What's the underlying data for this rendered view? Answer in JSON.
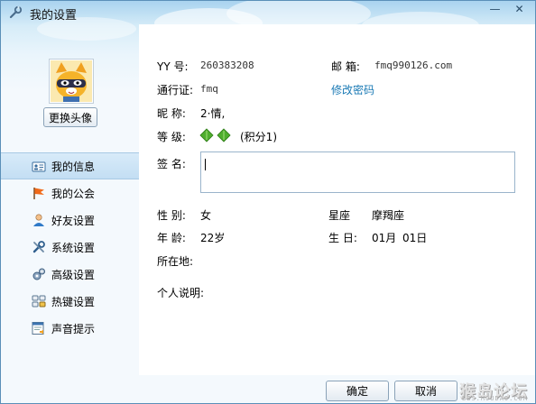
{
  "window": {
    "title": "我的设置",
    "controls": {
      "minimize": "—",
      "close": "✕"
    }
  },
  "sidebar": {
    "change_avatar_label": "更换头像",
    "items": [
      {
        "label": "我的信息",
        "icon": "card-icon",
        "active": true
      },
      {
        "label": "我的公会",
        "icon": "flag-icon",
        "active": false
      },
      {
        "label": "好友设置",
        "icon": "person-icon",
        "active": false
      },
      {
        "label": "系统设置",
        "icon": "wrench-icon",
        "active": false
      },
      {
        "label": "高级设置",
        "icon": "gears-icon",
        "active": false
      },
      {
        "label": "热键设置",
        "icon": "keyboard-icon",
        "active": false
      },
      {
        "label": "声音提示",
        "icon": "speaker-doc-icon",
        "active": false
      }
    ]
  },
  "profile": {
    "yy_label": "YY  号:",
    "yy_value": "260383208",
    "email_label": "邮  箱:",
    "email_value": "fmq990126.com",
    "passport_label": "通行证:",
    "passport_value": "fmq",
    "change_password_label": "修改密码",
    "nickname_label": "昵  称:",
    "nickname_value": "2·情,",
    "level_label": "等  级:",
    "level_points": "(积分1)",
    "signature_label": "签  名:",
    "signature_value": "",
    "gender_label": "性  别:",
    "gender_value": "女",
    "zodiac_label": "星座",
    "zodiac_value": "摩羯座",
    "age_label": "年  龄:",
    "age_value": "22岁",
    "birthday_label": "生  日:",
    "birthday_month": "01月",
    "birthday_day": "01日",
    "location_label": "所在地:",
    "location_value": "",
    "bio_label": "个人说明:",
    "bio_value": ""
  },
  "footer": {
    "ok_label": "确定",
    "cancel_label": "取消",
    "watermark": "猴岛论坛",
    "watermark_sub": "BBS.HOUDAO.COM"
  },
  "colors": {
    "accent_link": "#1a7ab5",
    "selected_item": "#c3def3",
    "border": "#5a8fb8"
  }
}
